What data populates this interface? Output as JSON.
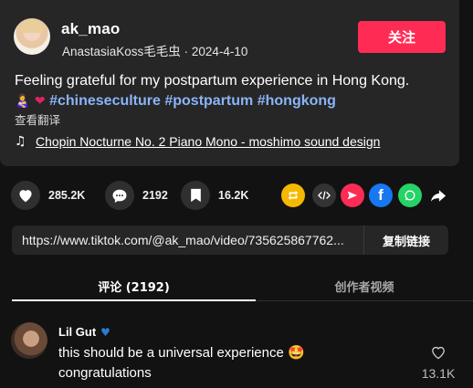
{
  "post": {
    "username": "ak_mao",
    "display_name": "AnastasiaKoss毛毛虫",
    "separator": " · ",
    "date": "2024-4-10",
    "follow_label": "关注",
    "caption_text": "Feeling grateful for my postpartum experience in Hong Kong.",
    "caption_emojis": [
      "woman-feeding-baby-emoji",
      "red-heart-emoji"
    ],
    "hashtags": [
      "#chineseculture",
      "#postpartum",
      "#hongkong"
    ],
    "translate_label": "查看翻译",
    "music_title": "Chopin Nocturne No. 2 Piano Mono - moshimo sound design"
  },
  "actions": {
    "likes": "285.2K",
    "comments": "2192",
    "saves": "16.2K",
    "share_targets": [
      "repost",
      "embed",
      "send",
      "facebook",
      "whatsapp",
      "share"
    ]
  },
  "link": {
    "url": "https://www.tiktok.com/@ak_mao/video/735625867762...",
    "copy_label": "复制链接"
  },
  "tabs": [
    {
      "label": "评论 (2192)",
      "active": true
    },
    {
      "label": "创作者视频",
      "active": false
    }
  ],
  "comments": [
    {
      "author": "Lil Gut",
      "badge_icon": "blue-heart-icon",
      "text_line1": "this should be a universal experience 🤩",
      "text_line2": "congratulations",
      "like_count": "13.1K"
    }
  ],
  "colors": {
    "accent": "#fe2c55",
    "hashtag": "#8ab4f8",
    "background": "#121212",
    "card": "#262626"
  }
}
